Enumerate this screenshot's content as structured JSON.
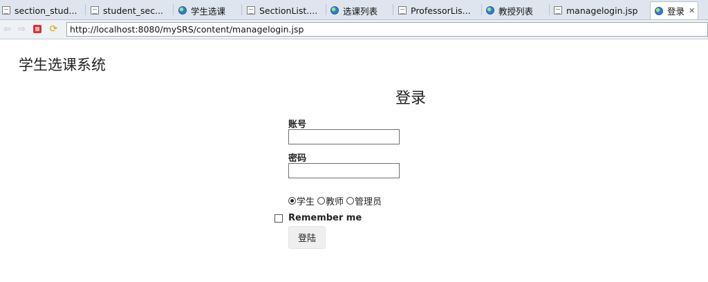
{
  "browser": {
    "tabs": [
      {
        "label": "section_stud...",
        "icon": "document-icon"
      },
      {
        "label": "student_sec...",
        "icon": "document-icon"
      },
      {
        "label": "学生选课",
        "icon": "globe-icon"
      },
      {
        "label": "SectionList....",
        "icon": "document-icon"
      },
      {
        "label": "选课列表",
        "icon": "globe-icon"
      },
      {
        "label": "ProfessorLis...",
        "icon": "document-icon"
      },
      {
        "label": "教授列表",
        "icon": "globe-icon"
      },
      {
        "label": "managelogin.jsp",
        "icon": "document-icon"
      },
      {
        "label": "登录",
        "icon": "globe-icon",
        "active": true,
        "close": "✕"
      }
    ],
    "url": "http://localhost:8080/mySRS/content/managelogin.jsp"
  },
  "page": {
    "site_title": "学生选课系统",
    "login_heading": "登录",
    "account_label": "账号",
    "account_value": "",
    "password_label": "密码",
    "password_value": "",
    "roles": [
      {
        "label": "学生",
        "checked": true
      },
      {
        "label": "教师",
        "checked": false
      },
      {
        "label": "管理员",
        "checked": false
      }
    ],
    "remember_label": "Remember me",
    "remember_checked": false,
    "submit_label": "登陆"
  }
}
